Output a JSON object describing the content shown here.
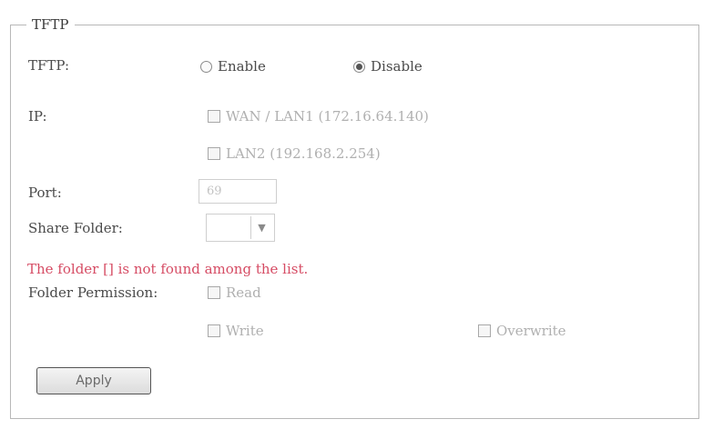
{
  "section": {
    "legend": "TFTP"
  },
  "tftp": {
    "label": "TFTP:",
    "enable_label": "Enable",
    "disable_label": "Disable",
    "selected": "Disable"
  },
  "ip": {
    "label": "IP:",
    "options": [
      {
        "label": "WAN / LAN1 (172.16.64.140)",
        "checked": false
      },
      {
        "label": "LAN2 (192.168.2.254)",
        "checked": false
      }
    ]
  },
  "port": {
    "label": "Port:",
    "value": "69"
  },
  "share_folder": {
    "label": "Share Folder:",
    "selected_value": ""
  },
  "error_message": "The folder [] is not found among the list.",
  "folder_permission": {
    "label": "Folder Permission:",
    "read_label": "Read",
    "write_label": "Write",
    "overwrite_label": "Overwrite"
  },
  "actions": {
    "apply_label": "Apply"
  },
  "colors": {
    "error": "#d64c64",
    "border": "#b8b8b8"
  }
}
